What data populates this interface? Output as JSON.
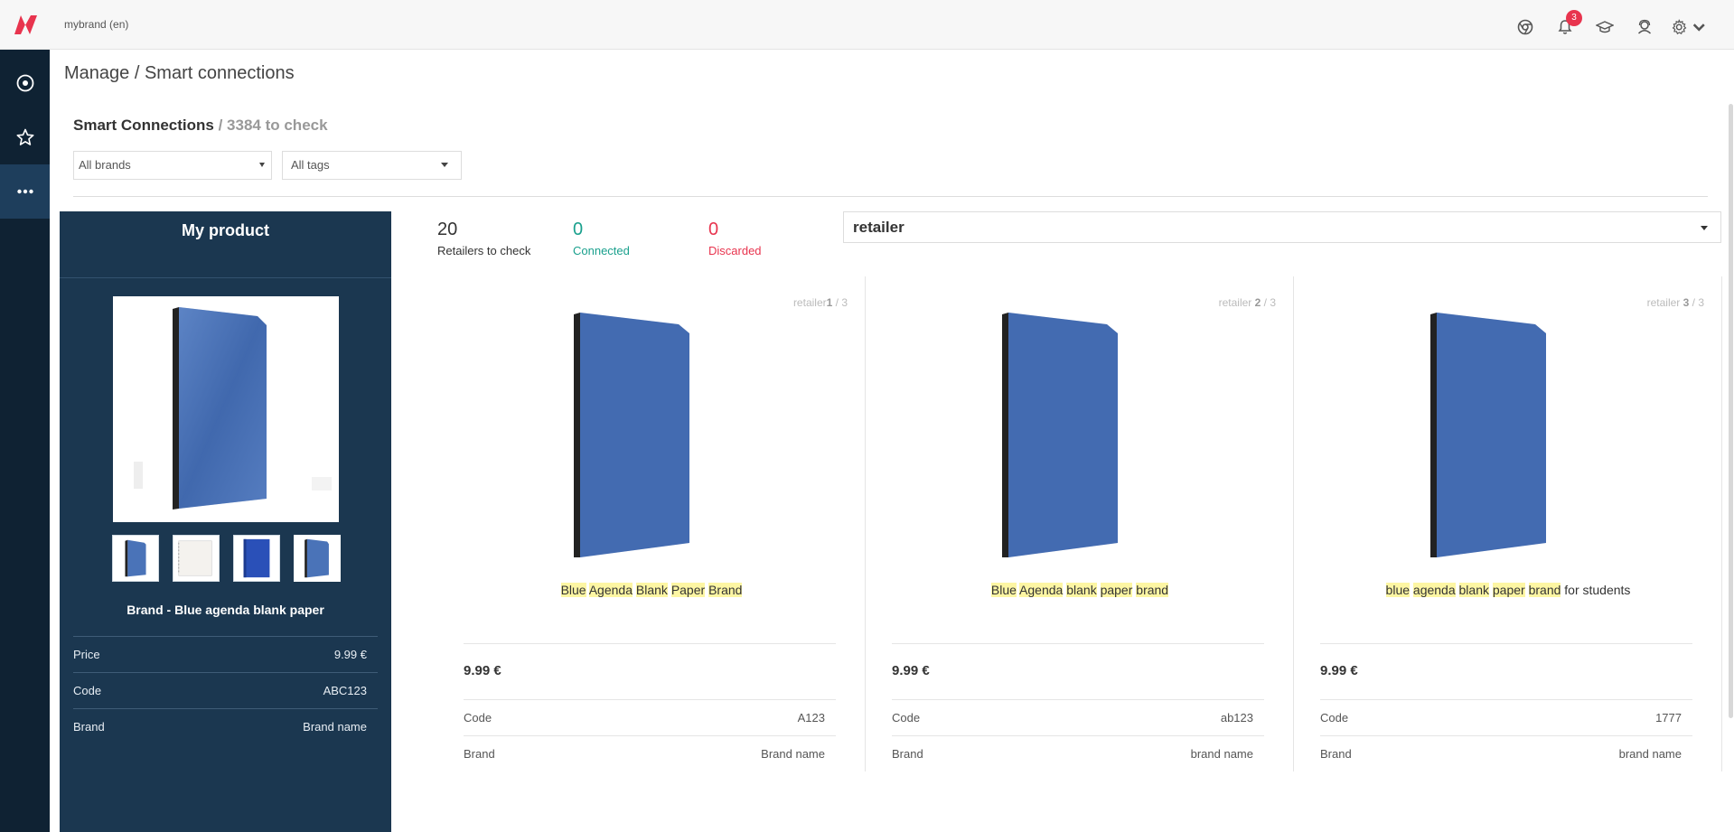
{
  "topbar": {
    "brand_switch": "mybrand (en)",
    "notification_count": "3"
  },
  "breadcrumb": "Manage / Smart connections",
  "smart_connections": {
    "title": "Smart Connections",
    "to_check": "/ 3384 to check"
  },
  "filters": {
    "brands": "All brands",
    "tags": "All tags"
  },
  "my_product": {
    "title": "My product",
    "name": "Brand - Blue agenda blank paper",
    "rows": [
      {
        "key": "Price",
        "value": "9.99 €"
      },
      {
        "key": "Code",
        "value": "ABC123"
      },
      {
        "key": "Brand",
        "value": "Brand name"
      }
    ]
  },
  "stats": {
    "to_check": {
      "num": "20",
      "label": "Retailers to check"
    },
    "connected": {
      "num": "0",
      "label": "Connected"
    },
    "discarded": {
      "num": "0",
      "label": "Discarded"
    }
  },
  "retailer_select": "retailer",
  "retailers": [
    {
      "index_prefix": "retailer",
      "index_num": "1",
      "index_total": " / 3",
      "name_parts": [
        {
          "t": "Blue",
          "hl": true
        },
        {
          "t": " ",
          "hl": false
        },
        {
          "t": "Agenda",
          "hl": true
        },
        {
          "t": " ",
          "hl": false
        },
        {
          "t": "Blank",
          "hl": true
        },
        {
          "t": " ",
          "hl": false
        },
        {
          "t": "Paper",
          "hl": true
        },
        {
          "t": " ",
          "hl": false
        },
        {
          "t": "Brand",
          "hl": true
        }
      ],
      "price": "9.99 €",
      "rows": [
        {
          "key": "Code",
          "value": "A123"
        },
        {
          "key": "Brand",
          "value": "Brand name"
        }
      ]
    },
    {
      "index_prefix": "retailer ",
      "index_num": "2",
      "index_total": " / 3",
      "name_parts": [
        {
          "t": "Blue",
          "hl": true
        },
        {
          "t": " ",
          "hl": false
        },
        {
          "t": "Agenda",
          "hl": true
        },
        {
          "t": " ",
          "hl": false
        },
        {
          "t": "blank",
          "hl": true
        },
        {
          "t": " ",
          "hl": false
        },
        {
          "t": "paper",
          "hl": true
        },
        {
          "t": " ",
          "hl": false
        },
        {
          "t": "brand",
          "hl": true
        }
      ],
      "price": "9.99 €",
      "rows": [
        {
          "key": "Code",
          "value": "ab123"
        },
        {
          "key": "Brand",
          "value": "brand name"
        }
      ]
    },
    {
      "index_prefix": "retailer ",
      "index_num": "3",
      "index_total": " / 3",
      "name_parts": [
        {
          "t": "blue",
          "hl": true
        },
        {
          "t": " ",
          "hl": false
        },
        {
          "t": "agenda",
          "hl": true
        },
        {
          "t": " ",
          "hl": false
        },
        {
          "t": "blank",
          "hl": true
        },
        {
          "t": " ",
          "hl": false
        },
        {
          "t": "paper",
          "hl": true
        },
        {
          "t": " ",
          "hl": false
        },
        {
          "t": "brand",
          "hl": true
        },
        {
          "t": " for students",
          "hl": false
        }
      ],
      "price": "9.99 €",
      "rows": [
        {
          "key": "Code",
          "value": "1777"
        },
        {
          "key": "Brand",
          "value": "brand name"
        }
      ]
    }
  ],
  "colors": {
    "sidebar": "#0f2233",
    "panel": "#1b3750",
    "accent_red": "#e8344e",
    "connected": "#1aa08d",
    "highlight": "#fdf6a3",
    "book_blue": "#4a73b8"
  },
  "icons": [
    "logo-icon",
    "chrome-icon",
    "bell-icon",
    "graduation-cap-icon",
    "user-support-icon",
    "gear-icon",
    "dashboard-icon",
    "star-icon",
    "more-icon"
  ]
}
